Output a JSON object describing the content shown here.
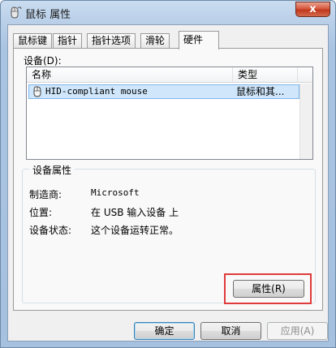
{
  "window": {
    "title": "鼠标 属性",
    "close_glyph": "x"
  },
  "tabs": [
    {
      "label": "鼠标键"
    },
    {
      "label": "指针"
    },
    {
      "label": "指针选项"
    },
    {
      "label": "滑轮"
    },
    {
      "label": "硬件"
    }
  ],
  "devices": {
    "label": "设备(D):",
    "columns": [
      "名称",
      "类型"
    ],
    "rows": [
      {
        "name": "HID-compliant mouse",
        "type": "鼠标和其..."
      }
    ]
  },
  "device_properties": {
    "title": "设备属性",
    "manufacturer_label": "制造商:",
    "manufacturer_value": "Microsoft",
    "location_label": "位置:",
    "location_value": "在 USB 输入设备 上",
    "status_label": "设备状态:",
    "status_value": "这个设备运转正常。",
    "properties_button": "属性(R)"
  },
  "footer": {
    "ok": "确定",
    "cancel": "取消",
    "apply": "应用(A)"
  }
}
